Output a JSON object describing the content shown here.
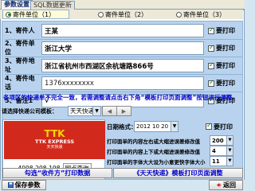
{
  "tabs": [
    {
      "label": "参数设置",
      "active": true
    },
    {
      "label": "SQL数据更新",
      "active": false
    }
  ],
  "radio_options": [
    {
      "label": "寄件单位（1）",
      "selected": true
    },
    {
      "label": "寄件单位（2）",
      "selected": false
    },
    {
      "label": "寄件单位（3）",
      "selected": false
    }
  ],
  "fields": [
    {
      "label": "1、寄件人",
      "value": "王某",
      "print_label": "要打印",
      "print": true
    },
    {
      "label": "2、寄件单位",
      "value": "浙江大学",
      "print_label": "要打印",
      "print": true
    },
    {
      "label": "3、寄件地址",
      "value": "浙江省杭州市西湖区余杭塘路866号",
      "print_label": "要打印",
      "print": true
    },
    {
      "label": "4、寄件电话",
      "value": "1376xxxxxxxx",
      "print_label": "要打印",
      "print": true
    },
    {
      "label": "5、备注1",
      "value": "√",
      "print_label": "要打印",
      "print": true
    }
  ],
  "notice": "各项区的快递单不完全一致，若需调整请点击右下角“模板打印页面调整”按钮进行调整。",
  "template": {
    "label": "请选择快递公司模板：",
    "selected": "天天快递"
  },
  "logo": {
    "brand": "TTK EXPRESS",
    "brand_cn": "天天快递",
    "hotline": "4008-208-198",
    "query_label": "网点查询"
  },
  "date": {
    "label": "日期格式：",
    "value": "2012  10  20",
    "print_label": "要打印",
    "print": true
  },
  "offsets": [
    {
      "label": "打印面单的内容左右或大缩进误差修改值",
      "value": "200"
    },
    {
      "label": "打印面单的内容上下或大缩进误差修改值",
      "value": "4"
    },
    {
      "label": "打印面单的字体大大设为小意更快字体大小",
      "value": "11"
    }
  ],
  "buttons": {
    "print_current": "勾选“收件方”打印数据",
    "template_adjust": "《天天快递》模板打印页面调整",
    "save": "保存参数",
    "back": "返回"
  },
  "colors": {
    "panel_bg": "#b9d3ef",
    "notice": "#0000cc",
    "logo_red": "#d12a1c",
    "check_green": "#0a7a0a"
  }
}
